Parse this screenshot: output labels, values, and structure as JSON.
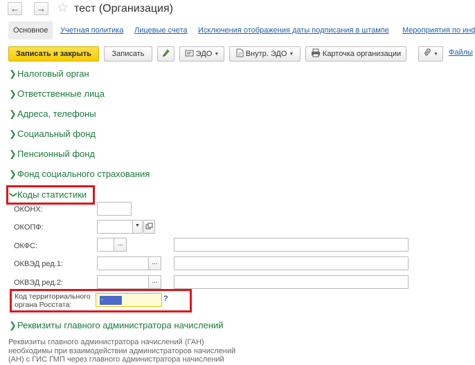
{
  "window": {
    "title": "тест (Организация)",
    "back_glyph": "←",
    "forward_glyph": "→",
    "star_glyph": "☆"
  },
  "tabs": [
    {
      "label": "Основное",
      "active": true
    },
    {
      "label": "Учетная политика"
    },
    {
      "label": "Лицевые счета"
    },
    {
      "label": "Исключения отображения даты подписания в штампе"
    },
    {
      "label": "Мероприятия по инф"
    }
  ],
  "toolbar": {
    "save_close_label": "Записать и закрыть",
    "save_label": "Записать",
    "edo_label": "ЭДО",
    "internal_edo_label": "Внутр. ЭДО",
    "org_card_label": "Карточка организации",
    "files_label": "Файлы",
    "caret_glyph": "▼"
  },
  "groups": {
    "tax_authority": "Налоговый орган",
    "responsible": "Ответственные лица",
    "addresses": "Адреса, телефоны",
    "social_fund": "Социальный фонд",
    "pension_fund": "Пенсионный фонд",
    "fss": "Фонд социального страхования",
    "stat_codes": "Коды статистики",
    "gan_requisites": "Реквизиты главного администратора начислений",
    "collapsed_glyph": "❯",
    "expanded_glyph": "❯"
  },
  "stat_form": {
    "okonh_label": "ОКОНХ:",
    "okonh_value": "",
    "okopf_label": "ОКОПФ:",
    "okopf_value": "",
    "okfs_label": "ОКФС:",
    "okfs_value": "",
    "okfs_description": "",
    "okved1_label": "ОКВЭД ред.1:",
    "okved1_value": "",
    "okved1_description": "",
    "okved2_label": "ОКВЭД ред.2:",
    "okved2_value": "",
    "okved2_description": "",
    "rosstat_label_line1": "Код территориального",
    "rosstat_label_line2": "органа Росстата:",
    "rosstat_value": "-",
    "help_glyph": "?",
    "dots_glyph": "...",
    "dropdown_glyph": "▼"
  },
  "footnote": {
    "line1": "Реквизиты главного администратора начислений (ГАН)",
    "line2": "необходимы при взаимодействии администраторов начислений",
    "line3": "(АН) с ГИС ГМП через главного администратора начислений"
  },
  "colors": {
    "group_text": "#1a7a3a",
    "link": "#1f5fa8",
    "primary_button": "#f5cc00",
    "highlight_frame": "#e0141e",
    "selection": "#4a6bc9"
  }
}
